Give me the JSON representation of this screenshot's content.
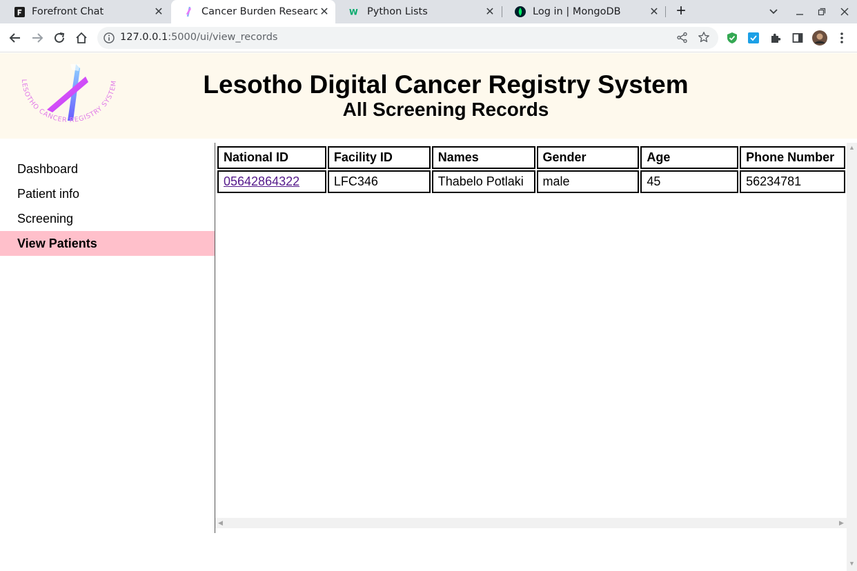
{
  "browser": {
    "tabs": [
      {
        "title": "Forefront Chat",
        "icon": "forefront-icon"
      },
      {
        "title": "Cancer Burden Research F",
        "icon": "ribbon-icon"
      },
      {
        "title": "Python Lists",
        "icon": "w3schools-icon"
      },
      {
        "title": "Log in | MongoDB",
        "icon": "mongodb-leaf-icon"
      }
    ],
    "url_host": "127.0.0.1",
    "url_rest": ":5000/ui/view_records"
  },
  "header": {
    "logo_text": "LESOTHO CANCER REGISTRY SYSTEM",
    "title": "Lesotho Digital Cancer Registry System",
    "subtitle": "All Screening Records"
  },
  "sidebar": {
    "items": [
      {
        "label": "Dashboard"
      },
      {
        "label": "Patient info"
      },
      {
        "label": "Screening"
      },
      {
        "label": "View Patients"
      }
    ],
    "active_index": 3
  },
  "table": {
    "headers": [
      "National ID",
      "Facility ID",
      "Names",
      "Gender",
      "Age",
      "Phone Number"
    ],
    "rows": [
      {
        "national_id": "05642864322",
        "facility_id": "LFC346",
        "names": "Thabelo Potlaki",
        "gender": "male",
        "age": "45",
        "phone": "56234781"
      }
    ]
  },
  "colors": {
    "header_bg": "#fef9ed",
    "active_nav_bg": "#ffc0cb",
    "link": "#551a8b"
  }
}
